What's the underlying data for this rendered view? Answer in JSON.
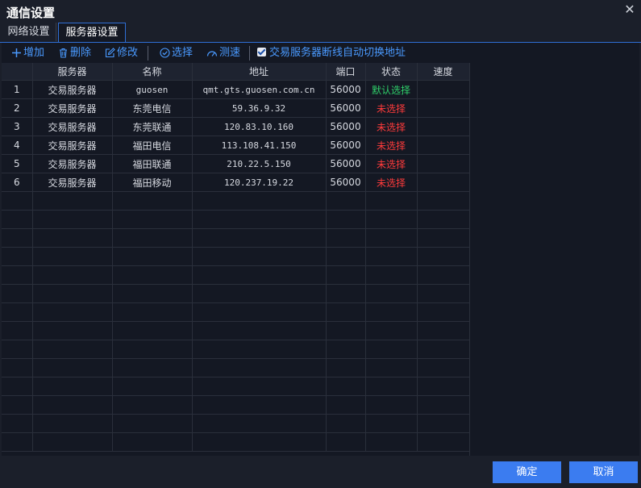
{
  "window": {
    "title": "通信设置",
    "close_icon": "close-icon"
  },
  "tabs": [
    {
      "label": "网络设置"
    },
    {
      "label": "服务器设置"
    }
  ],
  "toolbar": {
    "add_label": "增加",
    "delete_label": "删除",
    "edit_label": "修改",
    "select_label": "选择",
    "speedtest_label": "测速",
    "autoswitch_label": "交易服务器断线自动切换地址",
    "autoswitch_checked": true,
    "accent_color": "#4a9aff"
  },
  "table": {
    "columns": [
      "",
      "服务器",
      "名称",
      "地址",
      "端口",
      "状态",
      "速度"
    ],
    "rows": [
      {
        "no": "1",
        "server": "交易服务器",
        "name": "guosen",
        "address": "qmt.gts.guosen.com.cn",
        "port": "56000",
        "status": "默认选择",
        "status_type": "default",
        "speed": ""
      },
      {
        "no": "2",
        "server": "交易服务器",
        "name": "东莞电信",
        "address": "59.36.9.32",
        "port": "56000",
        "status": "未选择",
        "status_type": "unselected",
        "speed": ""
      },
      {
        "no": "3",
        "server": "交易服务器",
        "name": "东莞联通",
        "address": "120.83.10.160",
        "port": "56000",
        "status": "未选择",
        "status_type": "unselected",
        "speed": ""
      },
      {
        "no": "4",
        "server": "交易服务器",
        "name": "福田电信",
        "address": "113.108.41.150",
        "port": "56000",
        "status": "未选择",
        "status_type": "unselected",
        "speed": ""
      },
      {
        "no": "5",
        "server": "交易服务器",
        "name": "福田联通",
        "address": "210.22.5.150",
        "port": "56000",
        "status": "未选择",
        "status_type": "unselected",
        "speed": ""
      },
      {
        "no": "6",
        "server": "交易服务器",
        "name": "福田移动",
        "address": "120.237.19.22",
        "port": "56000",
        "status": "未选择",
        "status_type": "unselected",
        "speed": ""
      }
    ],
    "status_colors": {
      "default": "#2fcf6a",
      "unselected": "#ff3b3b"
    }
  },
  "footer": {
    "ok_label": "确定",
    "cancel_label": "取消",
    "button_color": "#3b7cf0"
  }
}
